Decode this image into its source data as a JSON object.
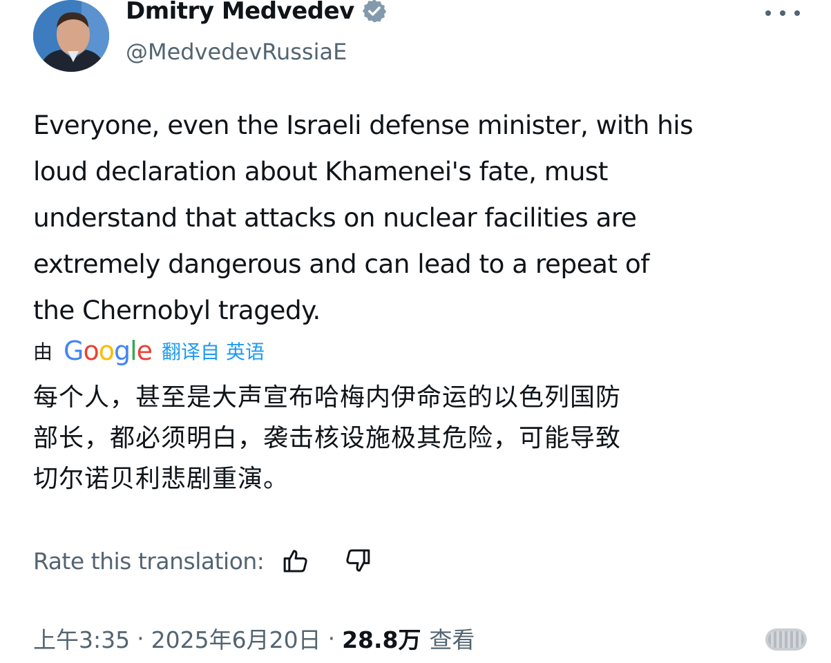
{
  "author": {
    "display_name": "Dmitry Medvedev",
    "handle": "@MedvedevRussiaE",
    "verified": true
  },
  "tweet": {
    "text_lines": [
      "Everyone, even the Israeli defense minister, with his",
      "loud declaration about Khamenei's fate, must",
      "understand that attacks on nuclear facilities are",
      "extremely dangerous and can lead to a repeat of",
      "the Chernobyl tragedy."
    ]
  },
  "translation": {
    "by_label": "由",
    "provider": "Google",
    "translated_from": "翻译自 英语",
    "text_lines": [
      "每个人，甚至是大声宣布哈梅内伊命运的以色列国防",
      "部长，都必须明白，袭击核设施极其危险，可能导致",
      "切尔诺贝利悲剧重演。"
    ],
    "rate_label": "Rate this translation:"
  },
  "meta": {
    "time": "上午3:35",
    "separator": "·",
    "date": "2025年6月20日",
    "views": "28.8万",
    "views_label": "查看"
  },
  "icons": {
    "more": "more-horizontal-icon",
    "verified": "verified-badge-icon",
    "thumbs_up": "thumbs-up-icon",
    "thumbs_down": "thumbs-down-icon"
  },
  "colors": {
    "text_primary": "#0f1419",
    "text_secondary": "#536471",
    "link": "#1d9bf0",
    "verified_badge": "#829aab"
  }
}
